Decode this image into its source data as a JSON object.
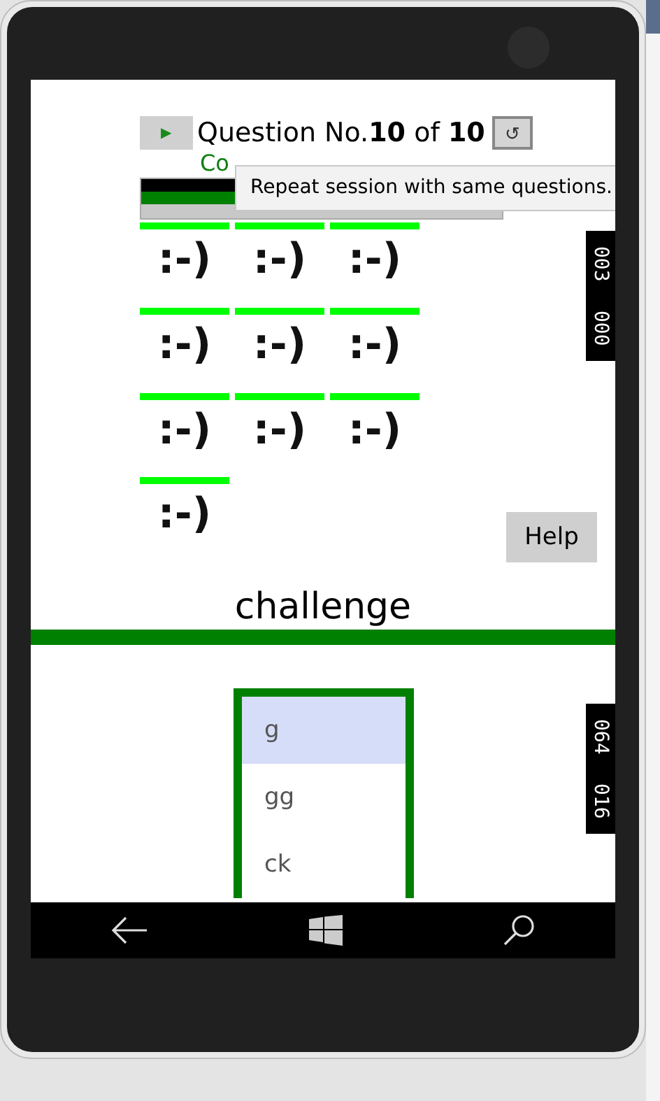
{
  "question": {
    "play": "▶",
    "text": "Question No.**10** of **10**",
    "reset": "↺"
  },
  "score": {
    "correct": "Co"
  },
  "tooltip": "Repeat session with same questions.",
  "progress": [
    {
      "kind": "answered",
      "level": 1
    },
    {
      "kind": "correct",
      "level": 1
    }
  ],
  "smileys": [
    {
      "text": ":-)"
    },
    {
      "text": ":-)"
    },
    {
      "text": ":-)"
    },
    {
      "text": ":-)"
    },
    {
      "text": ":-)"
    },
    {
      "text": ":-)"
    },
    {
      "text": ":-)"
    },
    {
      "text": ":-)"
    },
    {
      "text": ":-)"
    },
    {
      "text": ":-)"
    }
  ],
  "help": "Help",
  "word": "challenge",
  "options": [
    {
      "text": "g",
      "selected": true
    },
    {
      "text": "gg",
      "selected": false
    },
    {
      "text": "ck",
      "selected": false
    }
  ],
  "counters": [
    {
      "values": [
        "003",
        "000"
      ]
    },
    {
      "values": [
        "064",
        "016"
      ]
    }
  ]
}
